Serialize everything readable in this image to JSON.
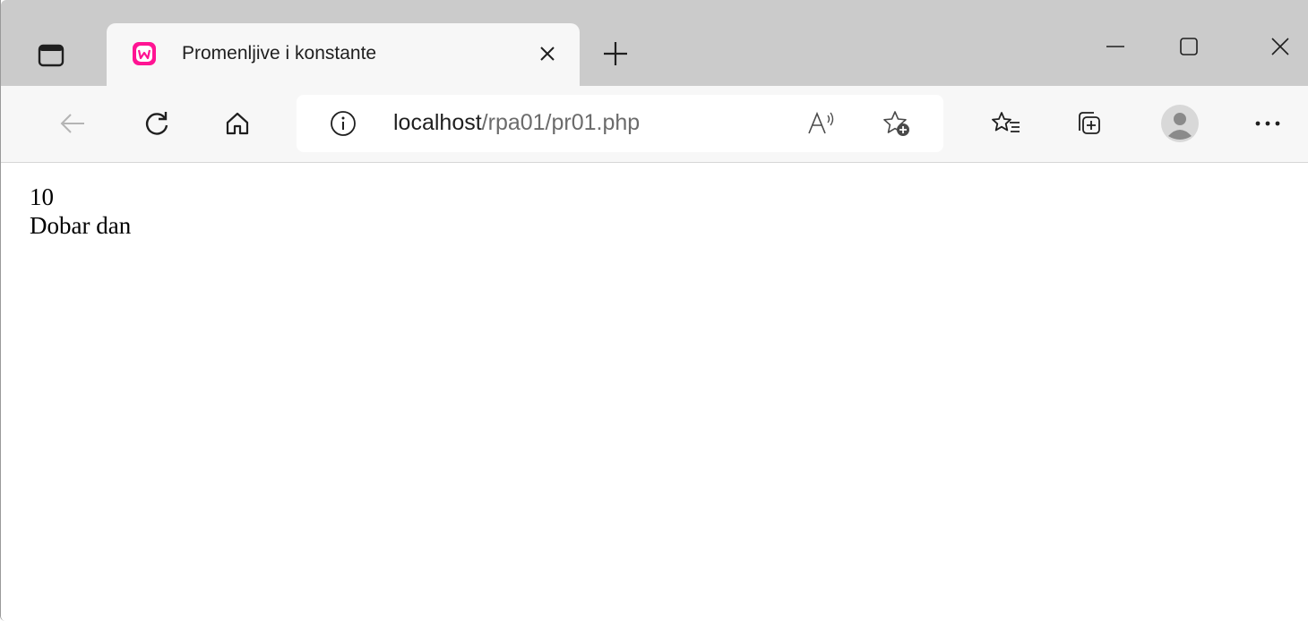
{
  "browser": {
    "tab": {
      "title": "Promenljive i konstante",
      "favicon": "wamp-icon"
    },
    "window_controls": [
      "minimize",
      "maximize",
      "close"
    ],
    "address": {
      "host": "localhost",
      "path": "/rpa01/pr01.php"
    }
  },
  "page": {
    "lines": [
      "10",
      "Dobar dan"
    ]
  },
  "colors": {
    "tabstrip": "#cbcbcb",
    "toolbar": "#f7f7f7",
    "favicon_accent": "#ff1493"
  }
}
